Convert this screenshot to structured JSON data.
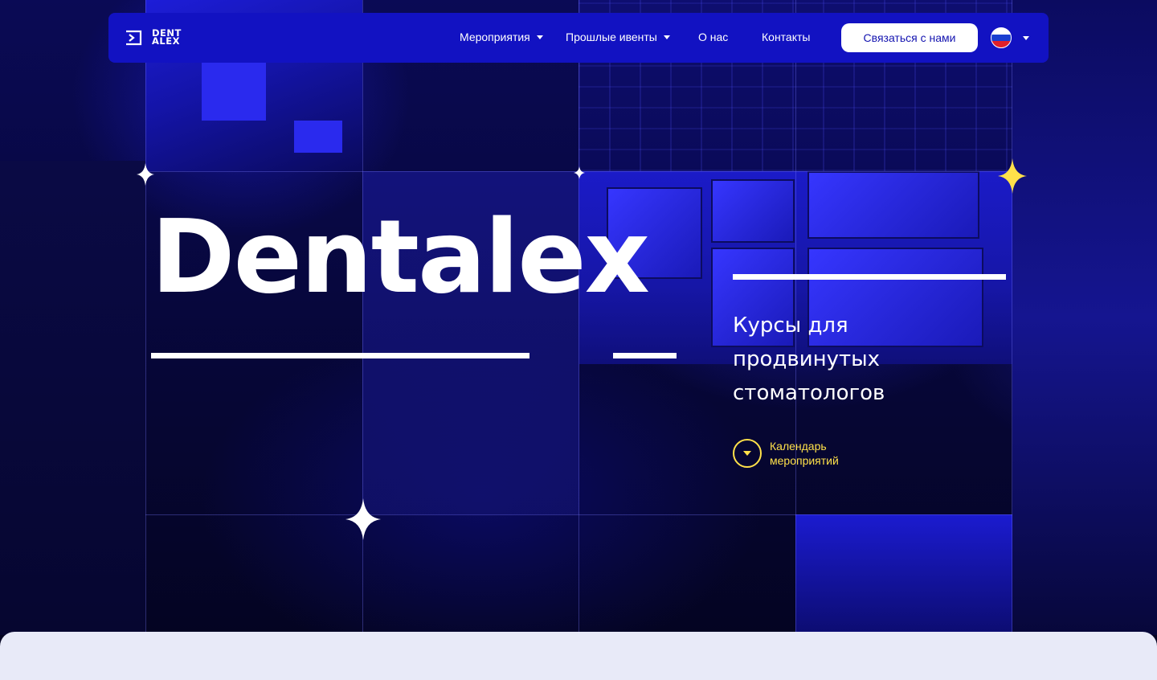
{
  "header": {
    "logo_text_line1": "DENT",
    "logo_text_line2": "ALEX",
    "nav": [
      {
        "label": "Мероприятия",
        "has_dropdown": true
      },
      {
        "label": "Прошлые ивенты",
        "has_dropdown": true
      },
      {
        "label": "О нас",
        "has_dropdown": false
      },
      {
        "label": "Контакты",
        "has_dropdown": false
      }
    ],
    "contact_button": "Связаться с нами",
    "language": {
      "icon": "russian-flag-icon",
      "has_dropdown": true
    }
  },
  "hero": {
    "title": "Dentalex",
    "subtitle": "Курсы для продвинутых стоматологов",
    "calendar_link": "Календарь мероприятий",
    "calendar_icon": "chevron-down-circle-icon"
  },
  "colors": {
    "navbar": "#1212c2",
    "accent_yellow": "#ffe14a",
    "button_bg": "#ffffff",
    "button_text": "#1414b0",
    "bottom_panel": "#e8eaf8"
  }
}
